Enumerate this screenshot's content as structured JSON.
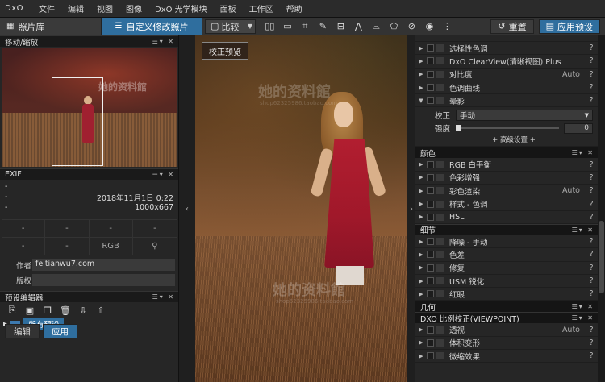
{
  "app": {
    "logo": "DxO"
  },
  "menu": [
    "文件",
    "编辑",
    "视图",
    "图像",
    "DxO 光学模块",
    "面板",
    "工作区",
    "帮助"
  ],
  "toolbar": {
    "library_tab": "照片库",
    "customize_tab": "自定义修改照片",
    "compare_label": "比较",
    "reset_label": "重置",
    "apply_preset_label": "应用预设"
  },
  "left": {
    "nav_title": "移动/缩放",
    "exif_title": "EXIF",
    "exif_line1_left": "-",
    "exif_line1_right": "",
    "exif_date_left": "-",
    "exif_date": "2018年11月1日 0:22",
    "exif_size": "1000x667",
    "exif_grid": [
      "-",
      "-",
      "-",
      "-",
      "-",
      "-",
      "RGB",
      ""
    ],
    "author_label": "作者",
    "author_value": "feitianwu7.com",
    "copyright_label": "版权",
    "copyright_value": "",
    "preset_editor_title": "预设编辑器",
    "preset_tree_label": "所有预设",
    "tab_edit": "编辑",
    "tab_apply": "应用"
  },
  "viewer": {
    "correction_button": "校正预览",
    "watermark_main": "她的资料館",
    "watermark_sub": "shop62325986.taobao.com"
  },
  "right": {
    "top_rows": [
      {
        "name": "选择性色调",
        "auto": ""
      },
      {
        "name": "DxO ClearView(清晰视图) Plus",
        "auto": ""
      },
      {
        "name": "对比度",
        "auto": "Auto"
      },
      {
        "name": "色调曲线",
        "auto": ""
      },
      {
        "name": "晕影",
        "auto": ""
      }
    ],
    "vignette": {
      "correction_label": "校正",
      "correction_value": "手动",
      "strength_label": "强度",
      "strength_value": "0",
      "advanced": "+ 高级设置 +"
    },
    "section_color": "颜色",
    "color_rows": [
      {
        "name": "RGB 白平衡",
        "auto": ""
      },
      {
        "name": "色彩增强",
        "auto": ""
      },
      {
        "name": "彩色渲染",
        "auto": "Auto"
      },
      {
        "name": "样式 - 色调",
        "auto": ""
      },
      {
        "name": "HSL",
        "auto": ""
      }
    ],
    "section_detail": "细节",
    "detail_rows": [
      {
        "name": "降噪 - 手动",
        "auto": ""
      },
      {
        "name": "色差",
        "auto": ""
      },
      {
        "name": "修复",
        "auto": ""
      },
      {
        "name": "USM 锐化",
        "auto": ""
      },
      {
        "name": "红眼",
        "auto": ""
      }
    ],
    "section_geometry": "几何",
    "section_viewpoint": "DXO 比例校正(VIEWPOINT)",
    "viewpoint_rows": [
      {
        "name": "透视",
        "auto": "Auto"
      },
      {
        "name": "体积变形",
        "auto": ""
      },
      {
        "name": "微缩效果",
        "auto": ""
      }
    ],
    "help": "?"
  },
  "colors": {
    "accent": "#2f6e9e"
  }
}
